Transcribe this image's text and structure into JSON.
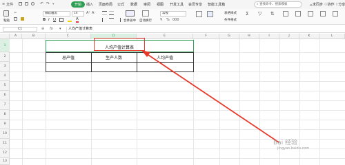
{
  "menubar": {
    "file": "文件",
    "tabs": [
      "开始",
      "插入",
      "页面布局",
      "公式",
      "数据",
      "审阅",
      "视图",
      "开发工具",
      "会员专享",
      "智能工具箱"
    ],
    "active_tab": "开始",
    "search_placeholder": "查找命令、搜索模板",
    "unsynced": "未同步",
    "collaborate": "协作",
    "share": "分享"
  },
  "ribbon": {
    "paste": "粘贴",
    "font_name": "微软雅黑",
    "font_size": "14",
    "merge_center": "合并居中",
    "wrap_text": "自动换行",
    "number_format": "常规",
    "conditional_format": "条件格式",
    "table_style": "表格样式"
  },
  "formula_bar": {
    "cell_ref": "C1",
    "fx": "fx",
    "content": "人均产值计算表"
  },
  "grid": {
    "columns": [
      "A",
      "B",
      "C",
      "D",
      "E",
      "F",
      "G",
      "H",
      "I",
      "J",
      "K",
      "L"
    ],
    "rows": [
      "1",
      "2",
      "3",
      "4",
      "5",
      "6",
      "7",
      "8",
      "9",
      "10",
      "11",
      "12",
      "13"
    ],
    "selected_column": "D"
  },
  "table": {
    "title": "人均产值计算表",
    "headers": [
      "总产值",
      "生产人数",
      "人均产值"
    ]
  },
  "watermark": {
    "brand": "Bai 经验",
    "url": "jingyan.baidu.com"
  },
  "colors": {
    "accent": "#2f9e54",
    "annotation": "#e8382b"
  }
}
